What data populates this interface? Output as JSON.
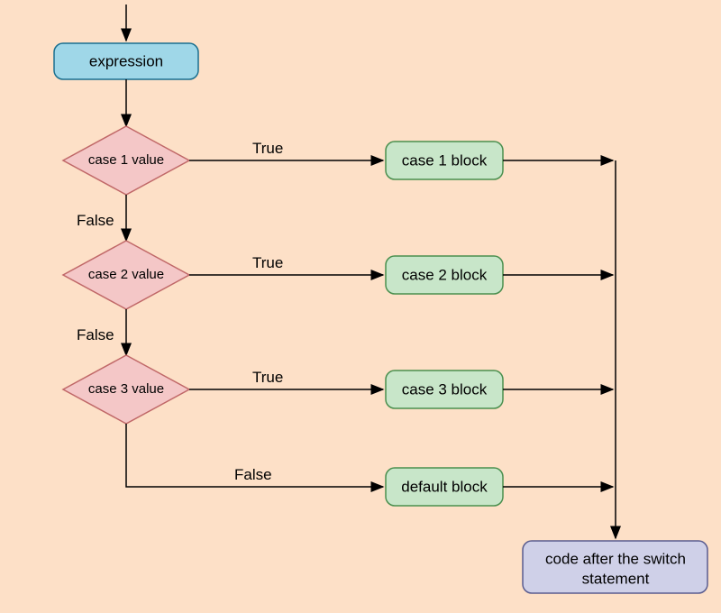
{
  "expression": {
    "label": "expression"
  },
  "decisions": {
    "case1": {
      "label": "case 1 value",
      "trueLabel": "True",
      "falseLabel": "False"
    },
    "case2": {
      "label": "case 2 value",
      "trueLabel": "True",
      "falseLabel": "False"
    },
    "case3": {
      "label": "case 3 value",
      "trueLabel": "True",
      "falseLabel": "False"
    }
  },
  "blocks": {
    "case1": "case 1 block",
    "case2": "case 2 block",
    "case3": "case 3 block",
    "default": "default block"
  },
  "final": {
    "line1": "code after the switch",
    "line2": "statement"
  },
  "colors": {
    "background": "#fde0c7",
    "expression": "#9fd7e8",
    "decision": "#f4c7c7",
    "block": "#c8e6c9",
    "final": "#cfd0e8"
  }
}
